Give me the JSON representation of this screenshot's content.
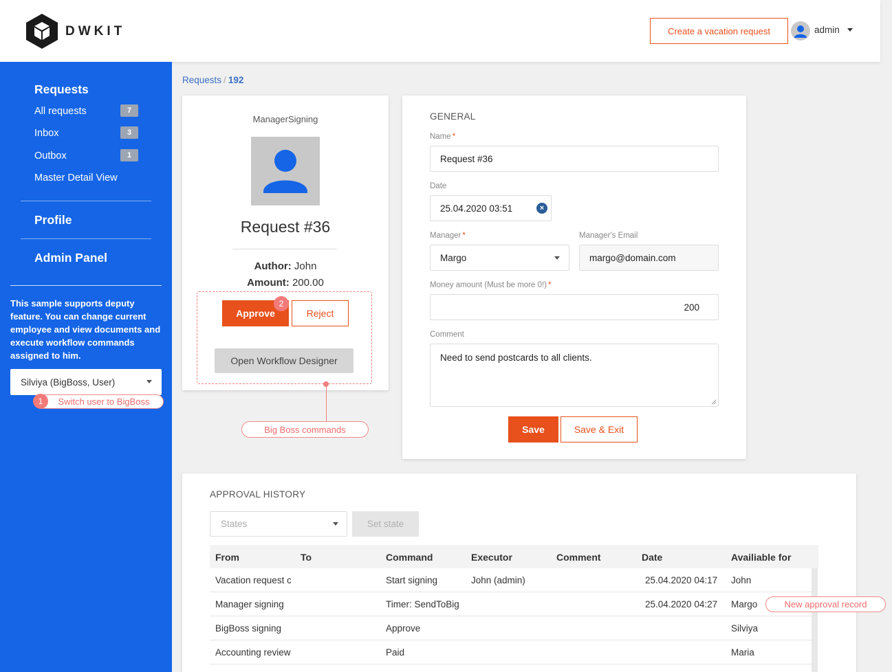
{
  "header": {
    "logo_text": "DWKIT",
    "create_button": "Create a vacation request",
    "user": "admin"
  },
  "sidebar": {
    "requests_heading": "Requests",
    "items": [
      {
        "label": "All requests",
        "badge": "7"
      },
      {
        "label": "Inbox",
        "badge": "3"
      },
      {
        "label": "Outbox",
        "badge": "1"
      },
      {
        "label": "Master Detail View"
      }
    ],
    "profile": "Profile",
    "admin_panel": "Admin Panel",
    "note": "This sample supports deputy feature. You can change current employee and view documents and execute workflow commands assigned to him.",
    "user_select": "Silviya (BigBoss, User)"
  },
  "annotations": {
    "step1_num": "1",
    "step1_text": "Switch user to BigBoss",
    "step2_num": "2",
    "bigboss_commands": "Big Boss commands",
    "new_record": "New approval record"
  },
  "breadcrumb": {
    "parent": "Requests",
    "separator": "/",
    "current": "192"
  },
  "profile_card": {
    "state": "ManagerSigning",
    "title": "Request #36",
    "author_label": "Author:",
    "author": "John",
    "amount_label": "Amount:",
    "amount": "200.00",
    "approve": "Approve",
    "reject": "Reject",
    "designer": "Open Workflow Designer"
  },
  "general": {
    "title": "GENERAL",
    "name_label": "Name",
    "name_value": "Request #36",
    "date_label": "Date",
    "date_value": "25.04.2020 03:51",
    "manager_label": "Manager",
    "manager_value": "Margo",
    "email_label": "Manager's Email",
    "email_value": "margo@domain.com",
    "money_label": "Money amount (Must be more 0!)",
    "money_value": "200",
    "comment_label": "Comment",
    "comment_value": "Need to send postcards to all clients.",
    "save": "Save",
    "save_exit": "Save & Exit",
    "required_mark": "*"
  },
  "history": {
    "title": "APPROVAL HISTORY",
    "states_placeholder": "States",
    "set_state": "Set state",
    "columns": [
      "From",
      "To",
      "Command",
      "Executor",
      "Comment",
      "Date",
      "Availiable for"
    ],
    "rows": [
      [
        "Vacation request created",
        "",
        "Start signing",
        "John (admin)",
        "",
        "25.04.2020 04:17",
        "John"
      ],
      [
        "Manager signing",
        "",
        "Timer: SendToBig",
        "",
        "",
        "25.04.2020 04:27",
        "Margo"
      ],
      [
        "BigBoss signing",
        "",
        "Approve",
        "",
        "",
        "",
        "Silviya"
      ],
      [
        "Accounting review",
        "",
        "Paid",
        "",
        "",
        "",
        "Maria"
      ]
    ]
  },
  "colors": {
    "primary_blue": "#1565e6",
    "accent_orange": "#e8501c",
    "annotation_red": "#f08080"
  }
}
